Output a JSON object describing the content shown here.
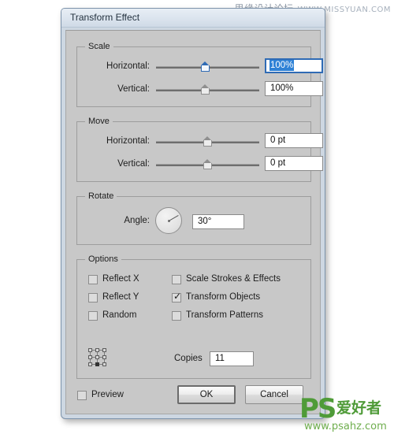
{
  "watermarks": {
    "top_cn": "思缘设计论坛",
    "top_url": "WWW.MISSYUAN.COM",
    "bottom_logo": "PS",
    "bottom_cn": "爱好者",
    "bottom_url": "www.psahz.com"
  },
  "dialog": {
    "title": "Transform Effect"
  },
  "scale": {
    "legend": "Scale",
    "horizontal_label": "Horizontal:",
    "horizontal_value": "100%",
    "vertical_label": "Vertical:",
    "vertical_value": "100%"
  },
  "move": {
    "legend": "Move",
    "horizontal_label": "Horizontal:",
    "horizontal_value": "0 pt",
    "vertical_label": "Vertical:",
    "vertical_value": "0 pt"
  },
  "rotate": {
    "legend": "Rotate",
    "angle_label": "Angle:",
    "angle_value": "30°"
  },
  "options": {
    "legend": "Options",
    "reflect_x": "Reflect X",
    "reflect_y": "Reflect Y",
    "random": "Random",
    "scale_strokes": "Scale Strokes & Effects",
    "transform_objects": "Transform Objects",
    "transform_patterns": "Transform Patterns",
    "transform_objects_checked": "✓",
    "copies_label": "Copies",
    "copies_value": "11"
  },
  "footer": {
    "preview_label": "Preview",
    "ok_label": "OK",
    "cancel_label": "Cancel"
  }
}
